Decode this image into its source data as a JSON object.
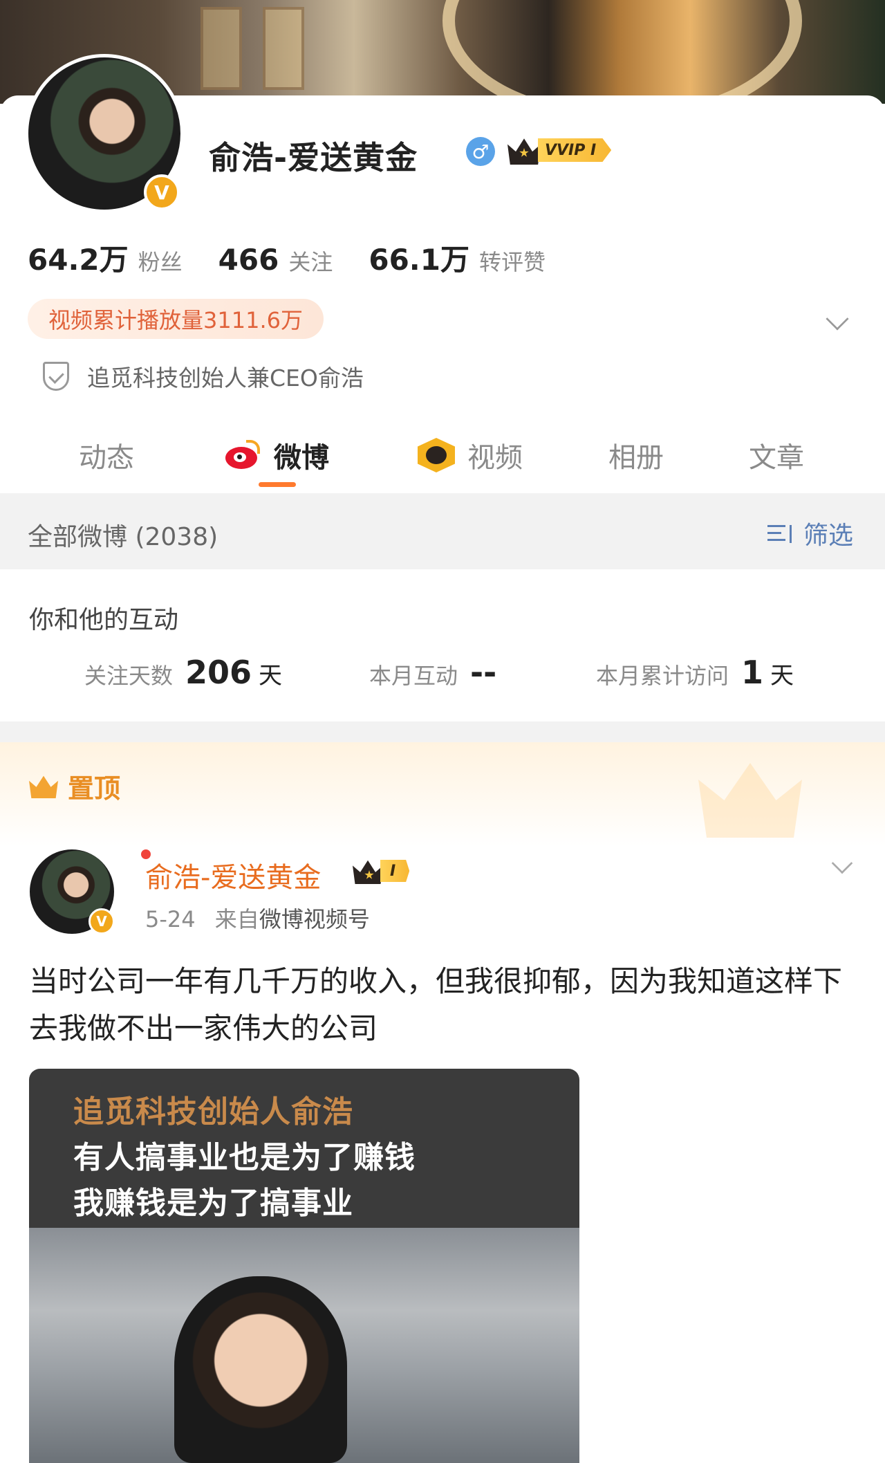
{
  "profile": {
    "name": "俞浩-爱送黄金",
    "gender_symbol": "♂",
    "vip_label": "VVIP I",
    "verified_symbol": "V",
    "stats": [
      {
        "value": "64.2万",
        "label": "粉丝"
      },
      {
        "value": "466",
        "label": "关注"
      },
      {
        "value": "66.1万",
        "label": "转评赞"
      }
    ],
    "play_count": "视频累计播放量3111.6万",
    "certification": "追觅科技创始人兼CEO俞浩"
  },
  "tabs": [
    {
      "label": "动态",
      "has_dot": true
    },
    {
      "label": "微博",
      "active": true,
      "icon": "weibo-icon"
    },
    {
      "label": "视频",
      "icon": "video-icon"
    },
    {
      "label": "相册"
    },
    {
      "label": "文章"
    }
  ],
  "filter_bar": {
    "title": "全部微博 (2038)",
    "filter_label": "筛选"
  },
  "interaction": {
    "heading": "你和他的互动",
    "items": [
      {
        "label": "关注天数",
        "value": "206",
        "unit": "天"
      },
      {
        "label": "本月互动",
        "value": "--",
        "unit": ""
      },
      {
        "label": "本月累计访问",
        "value": "1",
        "unit": "天"
      }
    ]
  },
  "pinned": {
    "label": "置顶"
  },
  "post": {
    "author": "俞浩-爱送黄金",
    "vip_label": "I",
    "date": "5-24",
    "source_prefix": "来自",
    "source": "微博视频号",
    "text": "当时公司一年有几千万的收入，但我很抑郁，因为我知道这样下去我做不出一家伟大的公司",
    "media_captions": [
      "追觅科技创始人俞浩",
      "有人搞事业也是为了赚钱",
      "我赚钱是为了搞事业"
    ]
  },
  "colors": {
    "accent": "#ff7a2e",
    "name_orange": "#e86c1f",
    "link_blue": "#5b7fb6"
  }
}
